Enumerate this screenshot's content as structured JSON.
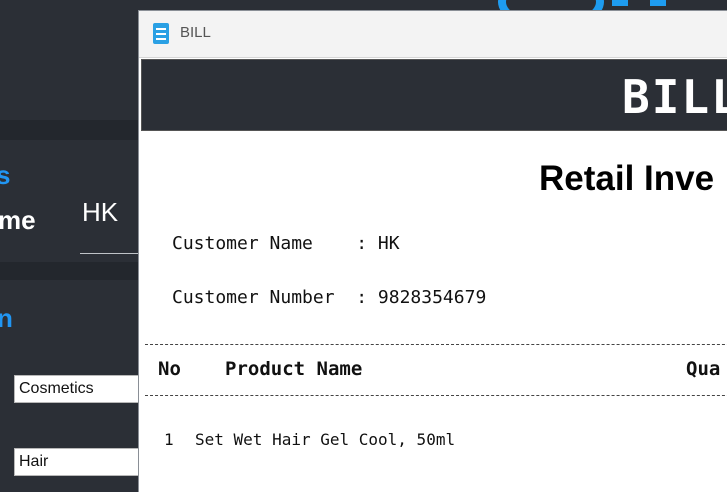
{
  "background_app": {
    "section_heading_fragment": "s",
    "name_label_fragment": "me",
    "name_value": "HK",
    "category_heading_fragment": "n",
    "category_select": "Cosmetics",
    "subcategory_select": "Hair",
    "brand_color": "#1e9cf0"
  },
  "window": {
    "title": "BILL",
    "header": "BILL",
    "invoice_title": "Retail Inve",
    "customer_name_label": "Customer Name    : ",
    "customer_name": "HK",
    "customer_number_label": "Customer Number  : ",
    "customer_number": "9828354679",
    "columns": {
      "no": "No",
      "product": "Product Name",
      "quantity": "Qua"
    },
    "items": [
      {
        "no": "1",
        "product": "Set Wet Hair Gel Cool, 50ml"
      }
    ]
  }
}
